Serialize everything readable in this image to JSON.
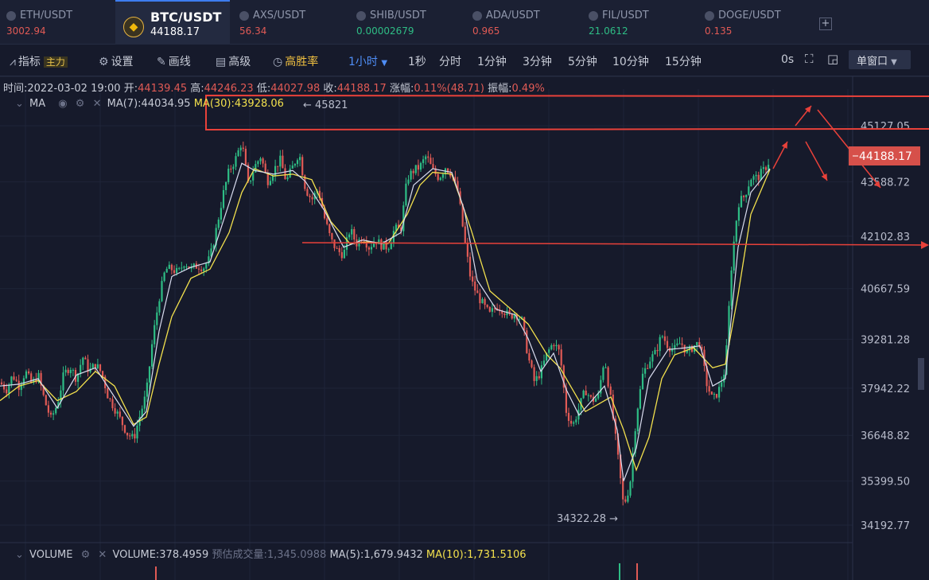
{
  "tickers": [
    {
      "pair": "ETH/USDT",
      "price": "3002.94",
      "color": "#e05a55"
    },
    {
      "pair": "BTC/USDT",
      "price": "44188.17",
      "color": "#ffffff",
      "active": true
    },
    {
      "pair": "AXS/USDT",
      "price": "56.34",
      "color": "#e05a55"
    },
    {
      "pair": "SHIB/USDT",
      "price": "0.00002679",
      "color": "#2ebd85"
    },
    {
      "pair": "ADA/USDT",
      "price": "0.965",
      "color": "#e05a55"
    },
    {
      "pair": "FIL/USDT",
      "price": "21.0612",
      "color": "#2ebd85"
    },
    {
      "pair": "DOGE/USDT",
      "price": "0.135",
      "color": "#e05a55"
    }
  ],
  "add_tab": "+",
  "toolbar": {
    "indicator": "指标",
    "main_tag": "主力",
    "settings": "设置",
    "draw": "画线",
    "advanced": "高级",
    "win_rate": "高胜率",
    "interval_selected": "1小时",
    "intervals": [
      "1秒",
      "分时",
      "1分钟",
      "3分钟",
      "5分钟",
      "10分钟",
      "15分钟"
    ],
    "countdown": "0s",
    "layout": "单窗口"
  },
  "ohlc": {
    "time_label": "时间:",
    "time": "2022-03-02 19:00",
    "open_label": "开:",
    "open": "44139.45",
    "high_label": "高:",
    "high": "44246.23",
    "low_label": "低:",
    "low": "44027.98",
    "close_label": "收:",
    "close": "44188.17",
    "change_label": "涨幅:",
    "change": "0.11%(48.71)",
    "amp_label": "振幅:",
    "amp": "0.49%"
  },
  "ma_legend": {
    "name": "MA",
    "ma7": "MA(7):44034.95",
    "ma30": "MA(30):43928.06"
  },
  "vol_legend": {
    "name": "VOLUME",
    "volume": "VOLUME:378.4959",
    "estimate": "预估成交量:1,345.0988",
    "ma5": "MA(5):1,679.9432",
    "ma10": "MA(10):1,731.5106"
  },
  "colors": {
    "up": "#2ebd85",
    "down": "#e05a55",
    "ma7": "#d9dcef",
    "ma30": "#f2e04d",
    "annot": "#e8413a",
    "bg": "#161a2b"
  },
  "chart_data": {
    "type": "candlestick",
    "y_axis_ticks": [
      45127.05,
      43588.72,
      42102.83,
      40667.59,
      39281.28,
      37942.22,
      36648.82,
      35399.5,
      34192.77
    ],
    "ylim": [
      33900,
      45700
    ],
    "last_price": "44188.17",
    "max_label": "← 45821",
    "min_label": "34322.28 →",
    "close_path": [
      [
        0,
        38100
      ],
      [
        8,
        37900
      ],
      [
        16,
        38300
      ],
      [
        24,
        38000
      ],
      [
        32,
        38400
      ],
      [
        40,
        38050
      ],
      [
        48,
        38300
      ],
      [
        56,
        37600
      ],
      [
        64,
        37100
      ],
      [
        72,
        37500
      ],
      [
        80,
        38300
      ],
      [
        88,
        38550
      ],
      [
        96,
        38200
      ],
      [
        104,
        38800
      ],
      [
        112,
        38400
      ],
      [
        120,
        38600
      ],
      [
        128,
        38350
      ],
      [
        136,
        37700
      ],
      [
        144,
        37400
      ],
      [
        152,
        37050
      ],
      [
        160,
        36700
      ],
      [
        168,
        36550
      ],
      [
        176,
        37200
      ],
      [
        184,
        37800
      ],
      [
        192,
        39300
      ],
      [
        200,
        40400
      ],
      [
        208,
        41200
      ],
      [
        216,
        41200
      ],
      [
        224,
        41100
      ],
      [
        232,
        41400
      ],
      [
        240,
        41200
      ],
      [
        248,
        41300
      ],
      [
        256,
        41250
      ],
      [
        264,
        41500
      ],
      [
        272,
        42300
      ],
      [
        280,
        43200
      ],
      [
        288,
        43900
      ],
      [
        296,
        44200
      ],
      [
        304,
        44700
      ],
      [
        312,
        43500
      ],
      [
        320,
        44000
      ],
      [
        328,
        44300
      ],
      [
        336,
        43600
      ],
      [
        344,
        43900
      ],
      [
        352,
        44200
      ],
      [
        360,
        43600
      ],
      [
        368,
        44000
      ],
      [
        376,
        44400
      ],
      [
        384,
        43400
      ],
      [
        392,
        43100
      ],
      [
        400,
        43400
      ],
      [
        408,
        42600
      ],
      [
        416,
        42000
      ],
      [
        424,
        41700
      ],
      [
        432,
        41600
      ],
      [
        440,
        42300
      ],
      [
        448,
        41900
      ],
      [
        456,
        42100
      ],
      [
        464,
        41800
      ],
      [
        472,
        42000
      ],
      [
        480,
        41850
      ],
      [
        488,
        41800
      ],
      [
        496,
        42300
      ],
      [
        504,
        42300
      ],
      [
        512,
        43700
      ],
      [
        520,
        43900
      ],
      [
        528,
        44000
      ],
      [
        536,
        44300
      ],
      [
        544,
        43900
      ],
      [
        552,
        43700
      ],
      [
        560,
        44000
      ],
      [
        568,
        43800
      ],
      [
        576,
        43300
      ],
      [
        584,
        42000
      ],
      [
        592,
        40900
      ],
      [
        600,
        40500
      ],
      [
        608,
        40200
      ],
      [
        616,
        39950
      ],
      [
        624,
        40200
      ],
      [
        632,
        40100
      ],
      [
        640,
        39900
      ],
      [
        648,
        40000
      ],
      [
        656,
        39800
      ],
      [
        664,
        38800
      ],
      [
        672,
        38100
      ],
      [
        680,
        38400
      ],
      [
        688,
        38900
      ],
      [
        696,
        39200
      ],
      [
        704,
        38900
      ],
      [
        712,
        37300
      ],
      [
        720,
        36900
      ],
      [
        728,
        37400
      ],
      [
        736,
        37900
      ],
      [
        744,
        37600
      ],
      [
        752,
        37700
      ],
      [
        760,
        38800
      ],
      [
        768,
        37600
      ],
      [
        776,
        36200
      ],
      [
        784,
        34700
      ],
      [
        792,
        35300
      ],
      [
        800,
        37200
      ],
      [
        808,
        38300
      ],
      [
        816,
        38700
      ],
      [
        824,
        38900
      ],
      [
        832,
        39400
      ],
      [
        840,
        39100
      ],
      [
        848,
        39000
      ],
      [
        856,
        39200
      ],
      [
        864,
        38900
      ],
      [
        872,
        39100
      ],
      [
        880,
        39200
      ],
      [
        888,
        38100
      ],
      [
        896,
        37600
      ],
      [
        904,
        37900
      ],
      [
        912,
        38500
      ],
      [
        920,
        41400
      ],
      [
        928,
        43000
      ],
      [
        936,
        43200
      ],
      [
        944,
        43700
      ],
      [
        952,
        43700
      ],
      [
        960,
        43900
      ],
      [
        968,
        44188
      ]
    ],
    "ma7_path": [
      [
        0,
        38000
      ],
      [
        24,
        38050
      ],
      [
        48,
        38200
      ],
      [
        72,
        37400
      ],
      [
        96,
        38300
      ],
      [
        120,
        38500
      ],
      [
        144,
        37700
      ],
      [
        168,
        36900
      ],
      [
        184,
        37300
      ],
      [
        200,
        39500
      ],
      [
        216,
        41000
      ],
      [
        240,
        41250
      ],
      [
        264,
        41400
      ],
      [
        288,
        43000
      ],
      [
        304,
        44100
      ],
      [
        320,
        43900
      ],
      [
        344,
        43800
      ],
      [
        368,
        43900
      ],
      [
        384,
        43600
      ],
      [
        408,
        42800
      ],
      [
        432,
        41800
      ],
      [
        456,
        42000
      ],
      [
        480,
        41900
      ],
      [
        504,
        42200
      ],
      [
        520,
        43500
      ],
      [
        544,
        43950
      ],
      [
        568,
        43850
      ],
      [
        584,
        42800
      ],
      [
        600,
        40900
      ],
      [
        624,
        40100
      ],
      [
        648,
        39950
      ],
      [
        664,
        39300
      ],
      [
        680,
        38400
      ],
      [
        696,
        38900
      ],
      [
        712,
        37900
      ],
      [
        728,
        37200
      ],
      [
        744,
        37600
      ],
      [
        760,
        38000
      ],
      [
        776,
        36800
      ],
      [
        784,
        35400
      ],
      [
        800,
        36300
      ],
      [
        816,
        38200
      ],
      [
        840,
        39000
      ],
      [
        864,
        39050
      ],
      [
        880,
        39100
      ],
      [
        896,
        38000
      ],
      [
        912,
        38200
      ],
      [
        928,
        41800
      ],
      [
        944,
        43300
      ],
      [
        968,
        43950
      ]
    ],
    "ma30_path": [
      [
        0,
        37600
      ],
      [
        24,
        38000
      ],
      [
        48,
        38150
      ],
      [
        72,
        37600
      ],
      [
        96,
        37850
      ],
      [
        120,
        38400
      ],
      [
        144,
        38000
      ],
      [
        168,
        36950
      ],
      [
        184,
        37150
      ],
      [
        200,
        38600
      ],
      [
        216,
        39900
      ],
      [
        240,
        40950
      ],
      [
        264,
        41200
      ],
      [
        288,
        42200
      ],
      [
        304,
        43300
      ],
      [
        320,
        43950
      ],
      [
        344,
        43750
      ],
      [
        368,
        43800
      ],
      [
        392,
        43650
      ],
      [
        416,
        42500
      ],
      [
        440,
        41900
      ],
      [
        464,
        41950
      ],
      [
        488,
        41900
      ],
      [
        512,
        42700
      ],
      [
        528,
        43500
      ],
      [
        544,
        43850
      ],
      [
        568,
        43800
      ],
      [
        592,
        42300
      ],
      [
        616,
        40600
      ],
      [
        640,
        40150
      ],
      [
        664,
        39700
      ],
      [
        688,
        38850
      ],
      [
        704,
        38500
      ],
      [
        720,
        37900
      ],
      [
        736,
        37300
      ],
      [
        752,
        37500
      ],
      [
        768,
        37700
      ],
      [
        784,
        36800
      ],
      [
        800,
        35700
      ],
      [
        816,
        36600
      ],
      [
        832,
        38200
      ],
      [
        848,
        38850
      ],
      [
        872,
        39050
      ],
      [
        896,
        38500
      ],
      [
        912,
        38600
      ],
      [
        928,
        40500
      ],
      [
        944,
        42700
      ],
      [
        968,
        43928
      ]
    ]
  }
}
